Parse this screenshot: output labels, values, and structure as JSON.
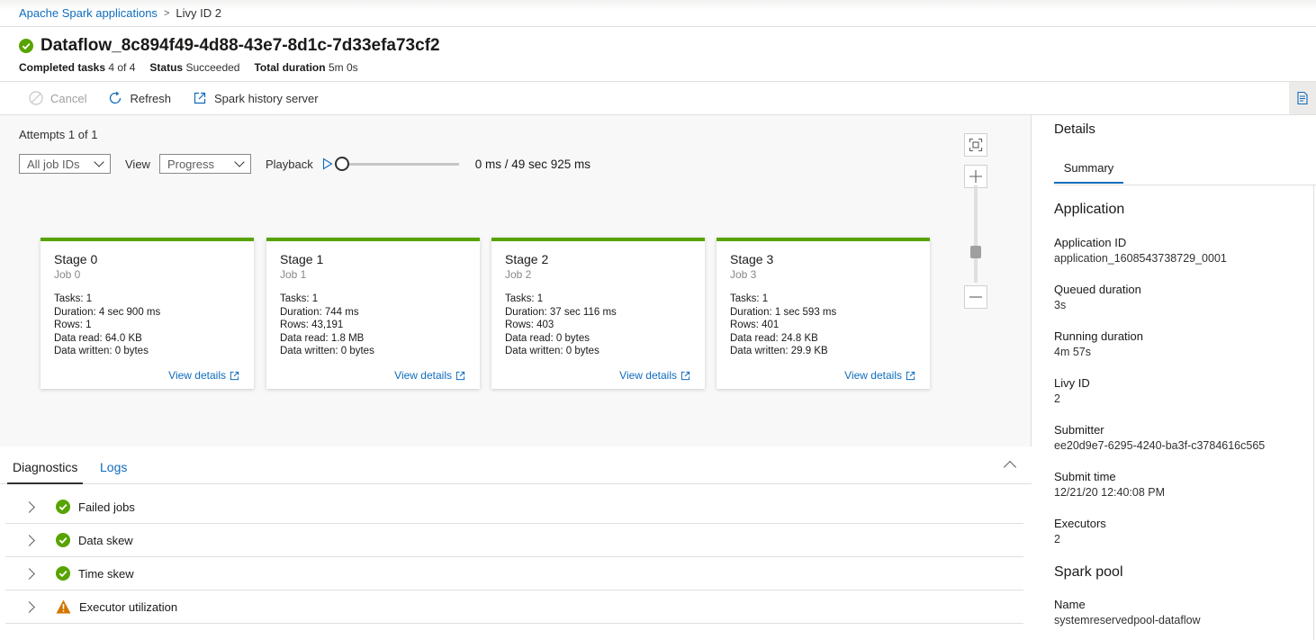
{
  "breadcrumb": {
    "root": "Apache Spark applications",
    "current": "Livy ID 2"
  },
  "header": {
    "title": "Dataflow_8c894f49-4d88-43e7-8d1c-7d33efa73cf2",
    "completed_label": "Completed tasks",
    "completed_value": "4 of 4",
    "status_label": "Status",
    "status_value": "Succeeded",
    "duration_label": "Total duration",
    "duration_value": "5m 0s"
  },
  "toolbar": {
    "cancel": "Cancel",
    "refresh": "Refresh",
    "history": "Spark history server"
  },
  "graph": {
    "attempts": "Attempts 1 of 1",
    "jobs_dropdown": "All job IDs",
    "view_label": "View",
    "view_dropdown": "Progress",
    "playback_label": "Playback",
    "playback_time": "0 ms / 49 sec 925 ms",
    "playback_progress": 0
  },
  "stages": [
    {
      "name": "Stage 0",
      "job": "Job 0",
      "tasks": "Tasks: 1",
      "duration": "Duration: 4 sec 900 ms",
      "rows": "Rows: 1",
      "read": "Data read:  64.0 KB",
      "written": "Data written:  0 bytes",
      "link": "View details"
    },
    {
      "name": "Stage 1",
      "job": "Job 1",
      "tasks": "Tasks: 1",
      "duration": "Duration: 744 ms",
      "rows": "Rows: 43,191",
      "read": "Data read:  1.8 MB",
      "written": "Data written:  0 bytes",
      "link": "View details"
    },
    {
      "name": "Stage 2",
      "job": "Job 2",
      "tasks": "Tasks: 1",
      "duration": "Duration: 37 sec 116 ms",
      "rows": "Rows: 403",
      "read": "Data read:  0 bytes",
      "written": "Data written:  0 bytes",
      "link": "View details"
    },
    {
      "name": "Stage 3",
      "job": "Job 3",
      "tasks": "Tasks: 1",
      "duration": "Duration: 1 sec 593 ms",
      "rows": "Rows: 401",
      "read": "Data read:  24.8 KB",
      "written": "Data written:  29.9 KB",
      "link": "View details"
    }
  ],
  "diagnostics": {
    "tabs": [
      "Diagnostics",
      "Logs"
    ],
    "rows": [
      {
        "label": "Failed jobs",
        "status": "success"
      },
      {
        "label": "Data skew",
        "status": "success"
      },
      {
        "label": "Time skew",
        "status": "success"
      },
      {
        "label": "Executor utilization",
        "status": "warning"
      }
    ]
  },
  "details": {
    "title": "Details",
    "tab": "Summary",
    "application_section": "Application",
    "fields": [
      {
        "label": "Application ID",
        "value": "application_1608543738729_0001"
      },
      {
        "label": "Queued duration",
        "value": "3s"
      },
      {
        "label": "Running duration",
        "value": "4m 57s"
      },
      {
        "label": "Livy ID",
        "value": "2"
      },
      {
        "label": "Submitter",
        "value": "ee20d9e7-6295-4240-ba3f-c3784616c565"
      },
      {
        "label": "Submit time",
        "value": "12/21/20 12:40:08 PM"
      },
      {
        "label": "Executors",
        "value": "2"
      }
    ],
    "pool_section": "Spark pool",
    "pool_fields": [
      {
        "label": "Name",
        "value": "systemreservedpool-dataflow"
      }
    ]
  },
  "colors": {
    "success": "#57a300",
    "warning": "#d47500",
    "link": "#0f6cbd"
  }
}
